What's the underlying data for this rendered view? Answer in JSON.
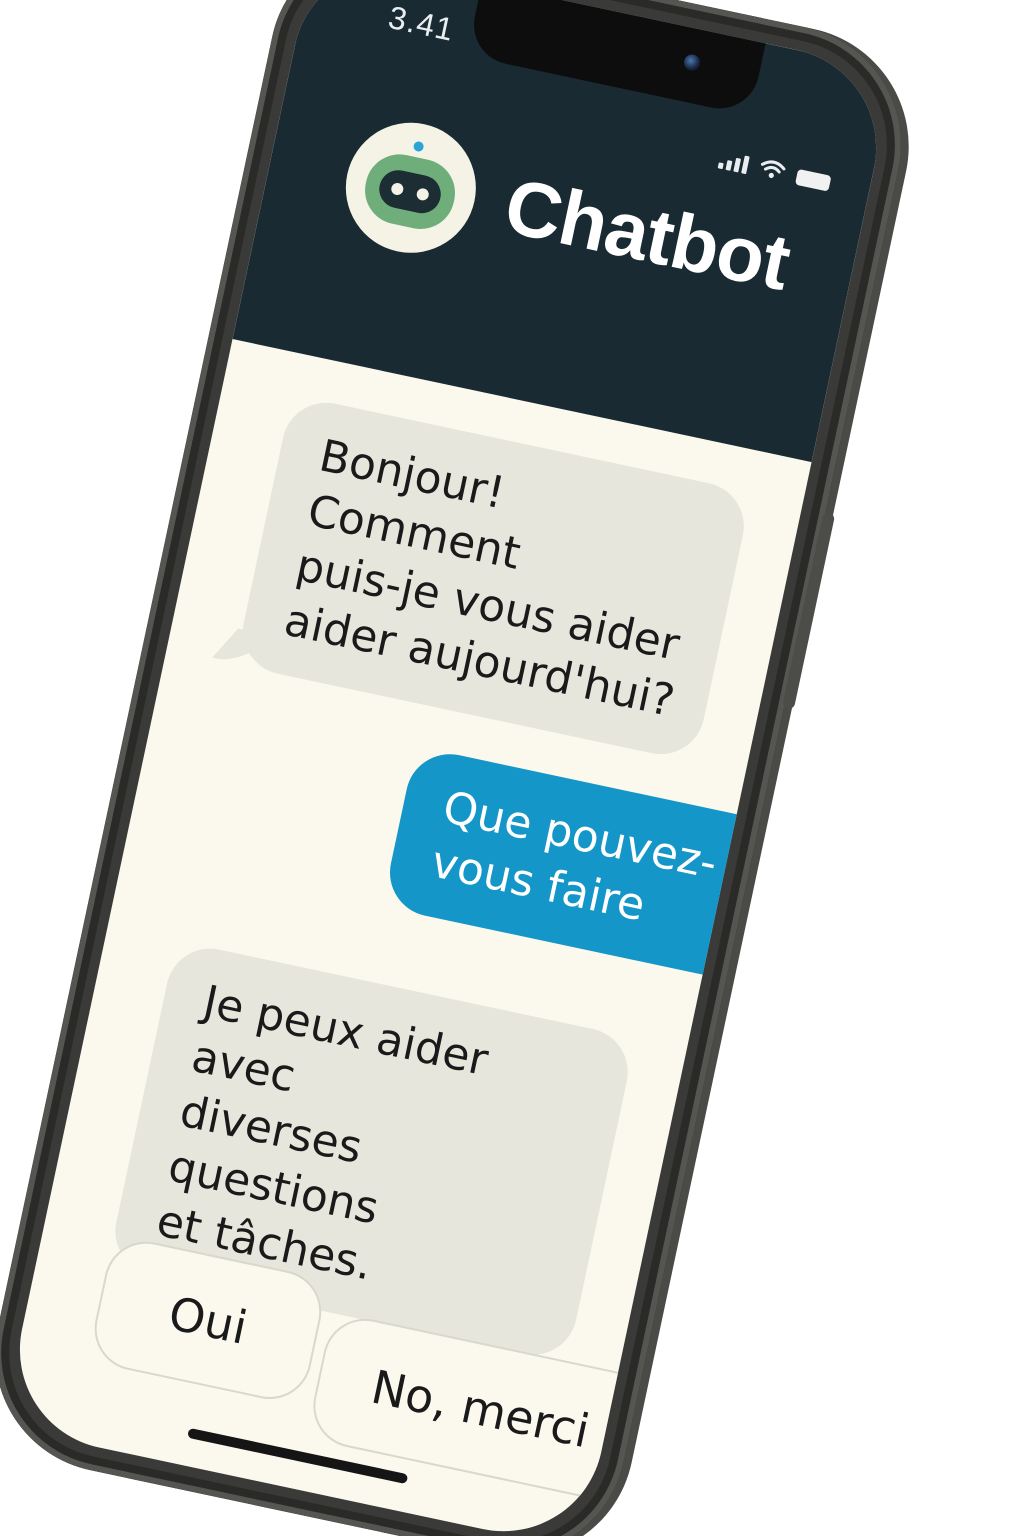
{
  "status_bar": {
    "time": "3.41",
    "icons": [
      "signal-icon",
      "wifi-icon",
      "battery-icon"
    ]
  },
  "header": {
    "title": "Chatbot",
    "avatar_icon": "robot-icon"
  },
  "messages": [
    {
      "sender": "bot",
      "text": "Bonjour! Comment\npuis-je vous aider\naider aujourd'hui?"
    },
    {
      "sender": "user",
      "text": "Que pouvez-\nvous faire"
    },
    {
      "sender": "bot",
      "text": "Je peux aider avec\ndiverses questions\net tâches."
    }
  ],
  "quick_replies": [
    {
      "label": "Oui"
    },
    {
      "label": "No, merci"
    }
  ],
  "colors": {
    "header_bg": "#192a33",
    "chat_bg": "#fbf9ee",
    "bot_bubble": "#e7e6dc",
    "user_bubble": "#1596c8",
    "avatar_green": "#6fae7a"
  }
}
